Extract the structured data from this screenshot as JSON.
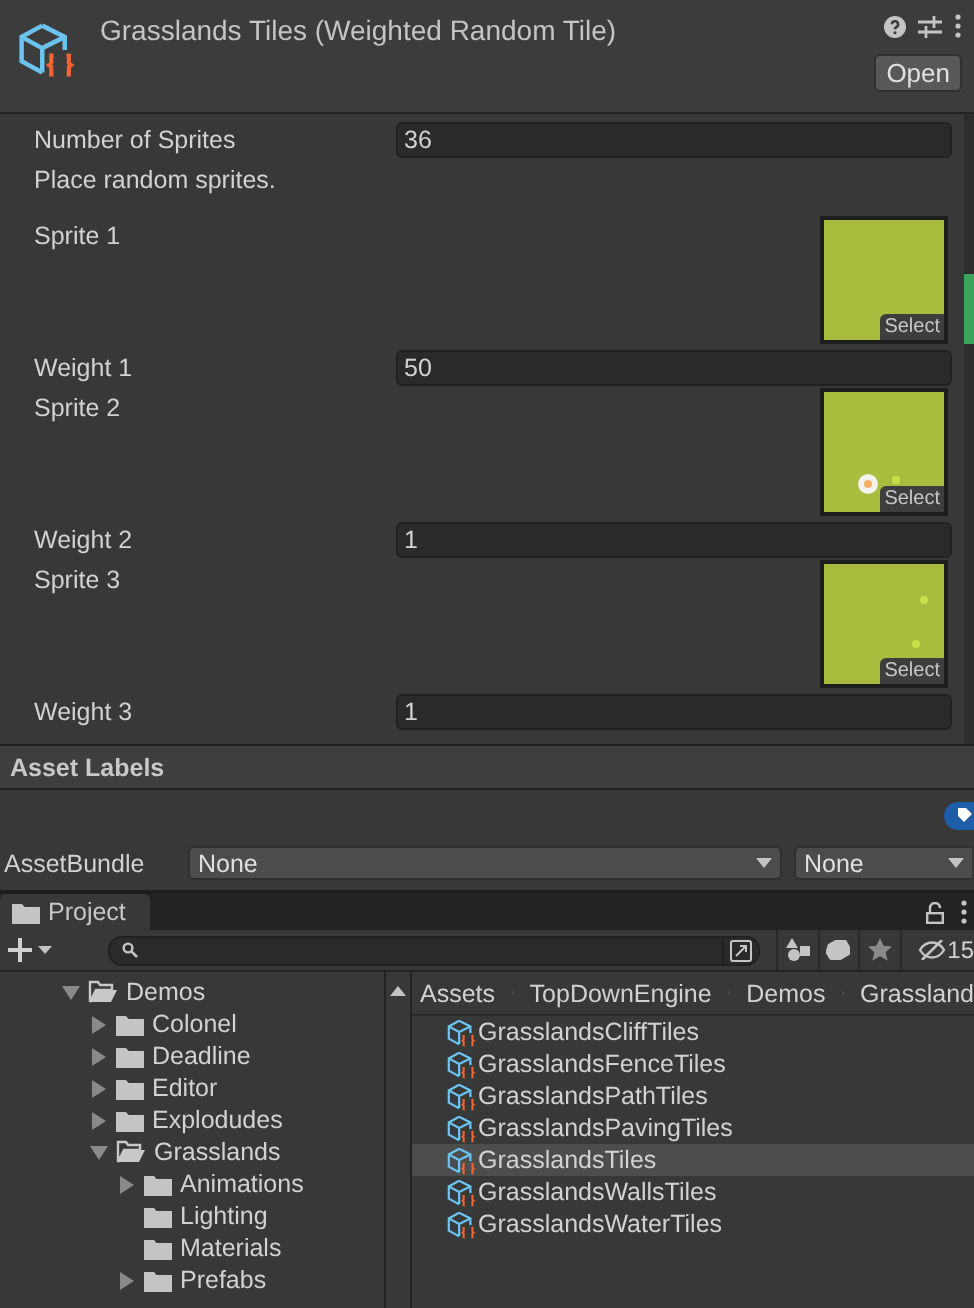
{
  "inspector": {
    "title": "Grasslands Tiles (Weighted Random Tile)",
    "open_button": "Open",
    "fields": [
      {
        "kind": "value",
        "label": "Number of Sprites",
        "value": "36"
      },
      {
        "kind": "note",
        "label": "Place random sprites."
      },
      {
        "kind": "sprite",
        "label": "Sprite 1",
        "button": "Select"
      },
      {
        "kind": "value",
        "label": "Weight 1",
        "value": "50"
      },
      {
        "kind": "sprite",
        "label": "Sprite 2",
        "button": "Select"
      },
      {
        "kind": "value",
        "label": "Weight 2",
        "value": "1"
      },
      {
        "kind": "sprite",
        "label": "Sprite 3",
        "button": "Select"
      },
      {
        "kind": "value",
        "label": "Weight 3",
        "value": "1"
      }
    ]
  },
  "asset_labels": {
    "title": "Asset Labels",
    "bundle_label": "AssetBundle",
    "bundle": "None",
    "variant": "None"
  },
  "project": {
    "tab": "Project",
    "hidden_count": "15",
    "tree": [
      {
        "label": "Demos",
        "expanded": true,
        "expandable": true,
        "children": [
          {
            "label": "Colonel",
            "expanded": false,
            "expandable": true
          },
          {
            "label": "Deadline",
            "expanded": false,
            "expandable": true
          },
          {
            "label": "Editor",
            "expanded": false,
            "expandable": true
          },
          {
            "label": "Explodudes",
            "expanded": false,
            "expandable": true
          },
          {
            "label": "Grasslands",
            "expanded": true,
            "expandable": true,
            "children": [
              {
                "label": "Animations",
                "expanded": false,
                "expandable": true
              },
              {
                "label": "Lighting",
                "expanded": false,
                "expandable": false
              },
              {
                "label": "Materials",
                "expanded": false,
                "expandable": false
              },
              {
                "label": "Prefabs",
                "expanded": false,
                "expandable": true
              }
            ]
          }
        ]
      }
    ],
    "breadcrumb": [
      "Assets",
      "TopDownEngine",
      "Demos",
      "Grassland"
    ],
    "files": [
      {
        "name": "GrasslandsCliffTiles",
        "selected": false
      },
      {
        "name": "GrasslandsFenceTiles",
        "selected": false
      },
      {
        "name": "GrasslandsPathTiles",
        "selected": false
      },
      {
        "name": "GrasslandsPavingTiles",
        "selected": false
      },
      {
        "name": "GrasslandsTiles",
        "selected": true
      },
      {
        "name": "GrasslandsWallsTiles",
        "selected": false
      },
      {
        "name": "GrasslandsWaterTiles",
        "selected": false
      }
    ]
  }
}
